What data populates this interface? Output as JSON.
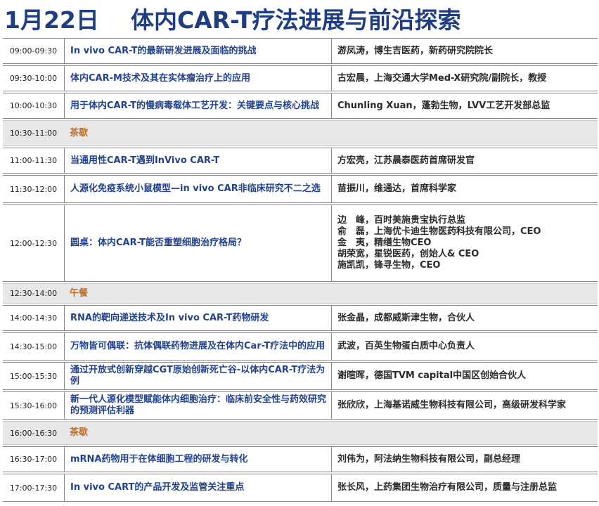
{
  "header": {
    "date": "1月22日",
    "title": "体内CAR-T疗法进展与前沿探索"
  },
  "colors": {
    "title": "#1f3d82",
    "topic": "#22428c",
    "break_label": "#c0702a",
    "break_bg": "#e7e7e7"
  },
  "rows": [
    {
      "time": "09:00-09:30",
      "topic": "In vivo CAR-T的最新研发进展及面临的挑战",
      "speaker": "游凤涛，博生吉医药，新药研究院院长"
    },
    {
      "time": "09:30-10:00",
      "topic": "体内CAR-M技术及其在实体瘤治疗上的应用",
      "speaker": "古宏晨，上海交通大学Med-X研究院/副院长，教授"
    },
    {
      "time": "10:00-10:30",
      "topic": "用于体内CAR-T的慢病毒载体工艺开发：关键要点与核心挑战",
      "speaker": "Chunling Xuan，蓬勃生物，LVV工艺开发部总监"
    },
    {
      "time": "10:30-11:00",
      "topic": "茶歇",
      "speaker": ""
    },
    {
      "time": "11:00-11:30",
      "topic": "当通用性CAR-T遇到InVivo CAR-T",
      "speaker": "方宏亮，江苏晨泰医药首席研发官"
    },
    {
      "time": "11:30-12:00",
      "topic": "人源化免疫系统小鼠模型—in vivo CAR非临床研究不二之选",
      "speaker": "苗振川，维通达，首席科学家"
    },
    {
      "time": "12:00-12:30",
      "topic": "圆桌：体内CAR-T能否重塑细胞治疗格局？",
      "speaker": "边　峰，百时美施贵宝执行总监\n俞　磊，上海优卡迪生物医药科技有限公司，CEO\n金　夷，精缮生物CEO\n胡荣宽，星锐医药，创始人& CEO\n施凯凯，锋寻生物，CEO"
    },
    {
      "time": "12:30-14:00",
      "topic": "午餐",
      "speaker": ""
    },
    {
      "time": "14:00-14:30",
      "topic": "RNA的靶向递送技术及In vivo CAR-T药物研发",
      "speaker": "张金晶，成都威斯津生物，合伙人"
    },
    {
      "time": "14:30-15:00",
      "topic": "万物皆可偶联：抗体偶联药物进展及在体内Car-T疗法中的应用",
      "speaker": "武波，百英生物蛋白质中心负责人"
    },
    {
      "time": "15:00-15:30",
      "topic": "通过开放式创新穿越CGT原始创新死亡谷-以体内CAR-T疗法为例",
      "speaker": "谢暄晖，德国TVM capital中国区创始合伙人"
    },
    {
      "time": "15:30-16:00",
      "topic": "新一代人源化模型赋能体内细胞治疗：临床前安全性与药效研究的预测评估利器",
      "speaker": "张欣欣，上海基诺威生物科技有限公司，高级研发科学家"
    },
    {
      "time": "16:00-16:30",
      "topic": "茶歇",
      "speaker": ""
    },
    {
      "time": "16:30-17:00",
      "topic": " mRNA药物用于在体细胞工程的研发与转化",
      "speaker": "刘伟为，阿法纳生物科技有限公司，副总经理"
    },
    {
      "time": "17:00-17:30",
      "topic": "In vivo CART的产品开发及监管关注重点",
      "speaker": "张长风，上药集团生物治疗有限公司，质量与注册总监"
    }
  ]
}
